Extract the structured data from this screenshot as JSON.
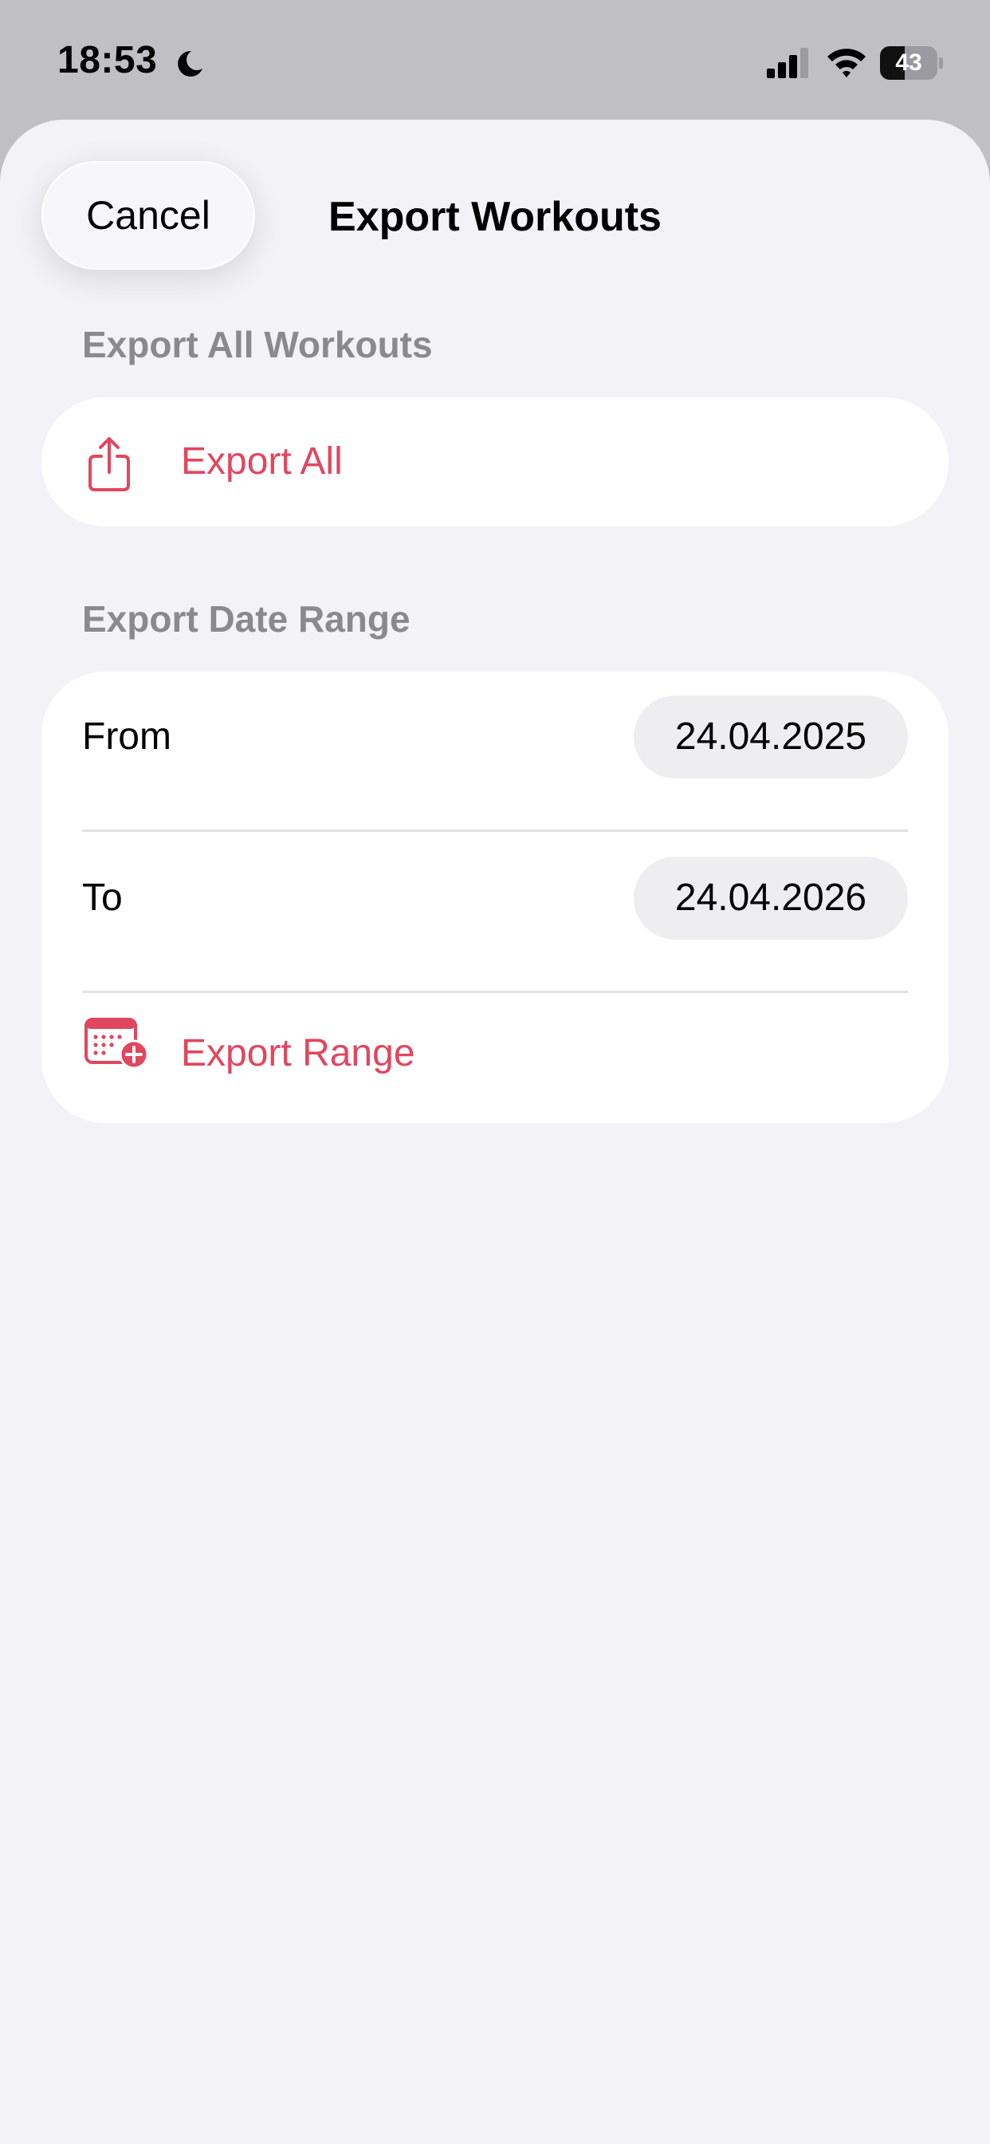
{
  "status_bar": {
    "time": "18:53",
    "battery_level": "43",
    "battery_fraction": 0.43
  },
  "header": {
    "cancel_label": "Cancel",
    "title": "Export Workouts"
  },
  "export_all": {
    "section_title": "Export All Workouts",
    "action_label": "Export All",
    "icon": "share-icon"
  },
  "export_range": {
    "section_title": "Export Date Range",
    "from_label": "From",
    "from_value": "24.04.2025",
    "to_label": "To",
    "to_value": "24.04.2026",
    "action_label": "Export Range",
    "icon": "calendar-add-icon"
  },
  "colors": {
    "accent": "#e0475f",
    "background": "#f2f2f7",
    "card": "#ffffff",
    "secondary_text": "#8a8a8e"
  }
}
